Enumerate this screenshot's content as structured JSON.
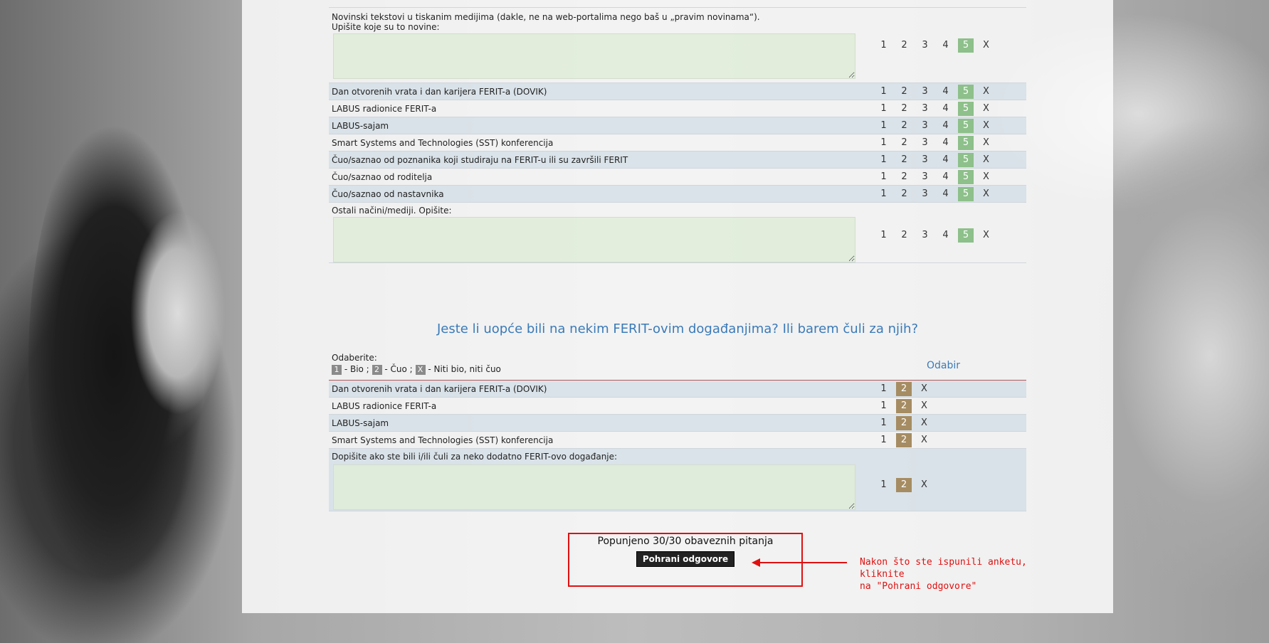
{
  "section1": {
    "intro_row": {
      "line1": "Novinski tekstovi u tiskanim medijima (dakle, ne na web-portalima nego baš u „pravim novinama“).",
      "line2": "Upišite koje su to novine:"
    },
    "scale": [
      "1",
      "2",
      "3",
      "4",
      "5",
      "X"
    ],
    "selected": "5",
    "rows": [
      "Dan otvorenih vrata i dan karijera FERIT-a (DOVIK)",
      "LABUS radionice FERIT-a",
      "LABUS-sajam",
      "Smart Systems and Technologies (SST) konferencija",
      "Čuo/saznao od poznanika koji studiraju na FERIT-u ili su završili FERIT",
      "Čuo/saznao od roditelja",
      "Čuo/saznao od nastavnika"
    ],
    "other_row": "Ostali načini/mediji. Opišite:"
  },
  "section2": {
    "heading": "Jeste li uopće bili na nekim FERIT-ovim događanjima? Ili barem čuli za njih?",
    "legend_title": "Odaberite:",
    "legend_items": [
      {
        "chip": "1",
        "text": " - Bio ; "
      },
      {
        "chip": "2",
        "text": " - Čuo ; "
      },
      {
        "chip": "X",
        "text": " - Niti bio, niti čuo"
      }
    ],
    "column_header": "Odabir",
    "scale": [
      "1",
      "2",
      "X"
    ],
    "selected": "2",
    "rows": [
      "Dan otvorenih vrata i dan karijera FERIT-a (DOVIK)",
      "LABUS radionice FERIT-a",
      "LABUS-sajam",
      "Smart Systems and Technologies (SST) konferencija"
    ],
    "other_row": "Dopišite ako ste bili i/ili čuli za neko dodatno FERIT-ovo događanje:"
  },
  "footer": {
    "status": "Popunjeno 30/30 obaveznih pitanja",
    "save_label": "Pohrani odgovore",
    "annotation_line1": "Nakon što ste ispunili anketu, kliknite",
    "annotation_line2": "na \"Pohrani odgovore\""
  },
  "colors": {
    "selected_5": "#8dc08a",
    "selected_2": "#a68c62",
    "heading": "#3a7ab8",
    "callout": "#e01010"
  }
}
